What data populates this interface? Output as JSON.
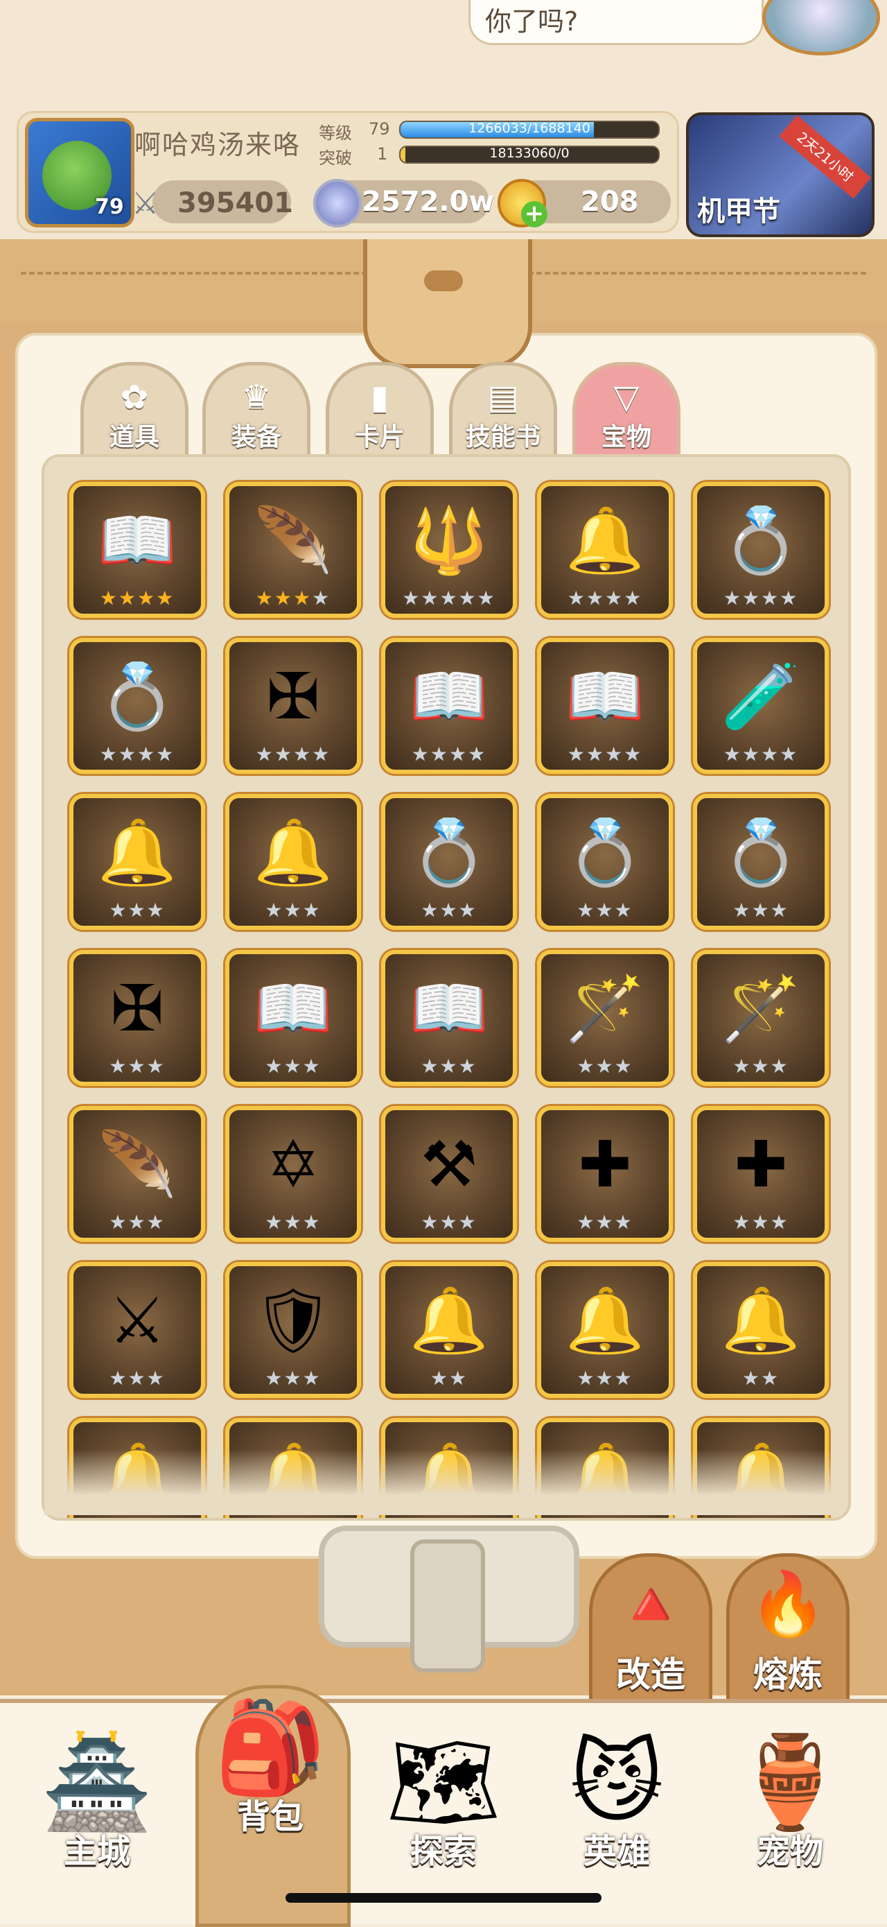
{
  "header": {
    "npc_bubble_text": "你了吗?",
    "player": {
      "name": "啊哈鸡汤来咯",
      "avatar_level": "79",
      "level_label": "等级",
      "level_value": "79",
      "level_progress_text": "1266033/1688140",
      "level_progress_fraction": 0.75,
      "breakthrough_label": "突破",
      "breakthrough_value": "1",
      "breakthrough_progress_text": "18133060/0",
      "breakthrough_progress_fraction": 0.0,
      "power": "395401"
    },
    "currency": {
      "coins": "2572.0w",
      "gold": "208"
    },
    "event": {
      "title": "机甲节",
      "ribbon": "2天21小时"
    }
  },
  "tabs": [
    {
      "label": "道具",
      "icon": "clover-icon",
      "glyph": "✿",
      "active": false
    },
    {
      "label": "装备",
      "icon": "armor-icon",
      "glyph": "♛",
      "active": false
    },
    {
      "label": "卡片",
      "icon": "card-icon",
      "glyph": "▮",
      "active": false
    },
    {
      "label": "技能书",
      "icon": "book-icon",
      "glyph": "▤",
      "active": false
    },
    {
      "label": "宝物",
      "icon": "treasure-icon",
      "glyph": "▽",
      "active": true
    }
  ],
  "treasures": [
    {
      "name": "book-icon",
      "glyph": "📖",
      "stars_gold": 4,
      "stars_total": 4
    },
    {
      "name": "feather-wing-icon",
      "glyph": "🪶",
      "stars_gold": 3,
      "stars_total": 4
    },
    {
      "name": "spear-icon",
      "glyph": "🔱",
      "stars_gold": 0,
      "stars_total": 5
    },
    {
      "name": "bell-icon",
      "glyph": "🔔",
      "stars_gold": 0,
      "stars_total": 4
    },
    {
      "name": "ring-icon",
      "glyph": "💍",
      "stars_gold": 0,
      "stars_total": 4
    },
    {
      "name": "ring-icon",
      "glyph": "💍",
      "stars_gold": 0,
      "stars_total": 4
    },
    {
      "name": "winged-cross-icon",
      "glyph": "✠",
      "stars_gold": 0,
      "stars_total": 4
    },
    {
      "name": "book-icon",
      "glyph": "📖",
      "stars_gold": 0,
      "stars_total": 4
    },
    {
      "name": "book-icon",
      "glyph": "📖",
      "stars_gold": 0,
      "stars_total": 4
    },
    {
      "name": "potion-icon",
      "glyph": "🧪",
      "stars_gold": 0,
      "stars_total": 4
    },
    {
      "name": "bell-icon",
      "glyph": "🔔",
      "stars_gold": 0,
      "stars_total": 3
    },
    {
      "name": "bell-icon",
      "glyph": "🔔",
      "stars_gold": 0,
      "stars_total": 3
    },
    {
      "name": "ring-icon",
      "glyph": "💍",
      "stars_gold": 0,
      "stars_total": 3
    },
    {
      "name": "ring-icon",
      "glyph": "💍",
      "stars_gold": 0,
      "stars_total": 3
    },
    {
      "name": "ring-icon",
      "glyph": "💍",
      "stars_gold": 0,
      "stars_total": 3
    },
    {
      "name": "winged-cross-icon",
      "glyph": "✠",
      "stars_gold": 0,
      "stars_total": 3
    },
    {
      "name": "book-icon",
      "glyph": "📖",
      "stars_gold": 0,
      "stars_total": 3
    },
    {
      "name": "book-icon",
      "glyph": "📖",
      "stars_gold": 0,
      "stars_total": 3
    },
    {
      "name": "staff-icon",
      "glyph": "🪄",
      "stars_gold": 0,
      "stars_total": 3
    },
    {
      "name": "staff-icon",
      "glyph": "🪄",
      "stars_gold": 0,
      "stars_total": 3
    },
    {
      "name": "feather-icon",
      "glyph": "🪶",
      "stars_gold": 0,
      "stars_total": 3
    },
    {
      "name": "star-sigil-icon",
      "glyph": "✡",
      "stars_gold": 0,
      "stars_total": 3
    },
    {
      "name": "scythe-icon",
      "glyph": "⚒",
      "stars_gold": 0,
      "stars_total": 3
    },
    {
      "name": "cross-icon",
      "glyph": "✚",
      "stars_gold": 0,
      "stars_total": 3
    },
    {
      "name": "cross-icon",
      "glyph": "✚",
      "stars_gold": 0,
      "stars_total": 3
    },
    {
      "name": "branch-icon",
      "glyph": "⚔",
      "stars_gold": 0,
      "stars_total": 3
    },
    {
      "name": "shield-icon",
      "glyph": "🛡",
      "stars_gold": 0,
      "stars_total": 3
    },
    {
      "name": "bell-icon",
      "glyph": "🔔",
      "stars_gold": 0,
      "stars_total": 2
    },
    {
      "name": "bell-icon",
      "glyph": "🔔",
      "stars_gold": 0,
      "stars_total": 3
    },
    {
      "name": "bell-icon",
      "glyph": "🔔",
      "stars_gold": 0,
      "stars_total": 2
    },
    {
      "name": "bell-icon",
      "glyph": "🔔",
      "stars_gold": 0,
      "stars_total": 0
    },
    {
      "name": "bell-icon",
      "glyph": "🔔",
      "stars_gold": 0,
      "stars_total": 0
    },
    {
      "name": "bell-icon",
      "glyph": "🔔",
      "stars_gold": 0,
      "stars_total": 0
    },
    {
      "name": "bell-icon",
      "glyph": "🔔",
      "stars_gold": 0,
      "stars_total": 0
    },
    {
      "name": "bell-icon",
      "glyph": "🔔",
      "stars_gold": 0,
      "stars_total": 0
    }
  ],
  "actions": {
    "reforge_label": "改造",
    "smelt_label": "熔炼"
  },
  "nav": [
    {
      "label": "主城",
      "icon": "castle-icon",
      "glyph": "🏯"
    },
    {
      "label": "背包",
      "icon": "backpack-icon",
      "glyph": "🎒"
    },
    {
      "label": "探索",
      "icon": "map-icon",
      "glyph": "🗺"
    },
    {
      "label": "英雄",
      "icon": "hero-icon",
      "glyph": "😼"
    },
    {
      "label": "宠物",
      "icon": "pet-icon",
      "glyph": "🏺"
    }
  ],
  "colors": {
    "frame_gold": "#f4c645",
    "active_tab": "#f0a2a2",
    "bag_brown": "#dbb07a"
  }
}
